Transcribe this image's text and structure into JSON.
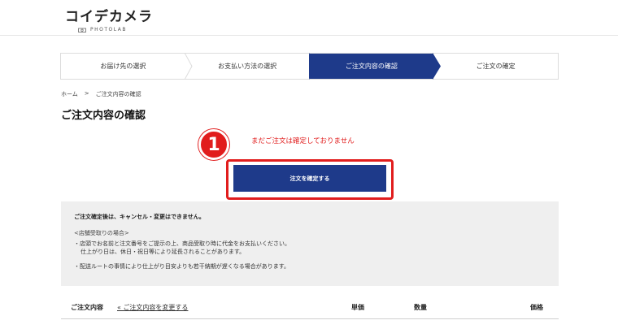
{
  "header": {
    "logo_main": "コイデカメラ",
    "logo_sub": "PHOTOLAB"
  },
  "steps": [
    {
      "label": "お届け先の選択",
      "active": false
    },
    {
      "label": "お支払い方法の選択",
      "active": false
    },
    {
      "label": "ご注文内容の確認",
      "active": true
    },
    {
      "label": "ご注文の確定",
      "active": false
    }
  ],
  "breadcrumb": {
    "home": "ホーム",
    "separator": ">",
    "current": "ご注文内容の確認"
  },
  "page_title": "ご注文内容の確認",
  "callout": {
    "number": "1",
    "color": "#e11d1d"
  },
  "warning_text": "まだご注文は確定しておりません",
  "confirm_button_label": "注文を確定する",
  "notice": {
    "title": "ご注文確定後は、キャンセル・変更はできません。",
    "subtitle": "<店舗受取りの場合>",
    "line1": "・店頭でお名前と注文番号をご提示の上、商品受取り時に代金をお支払いください。",
    "line2": "仕上がり日は、休日・祝日等により延長されることがあります。",
    "line3": "・配送ルートの事情により仕上がり目安よりも若干納期が遅くなる場合があります。"
  },
  "order_table": {
    "label": "ご注文内容",
    "change_link": "« ご注文内容を変更する",
    "col_price": "単価",
    "col_qty": "数量",
    "col_total": "価格"
  },
  "colors": {
    "accent": "#1e3a8a",
    "alert": "#e11d1d",
    "notice_bg": "#efefef"
  }
}
